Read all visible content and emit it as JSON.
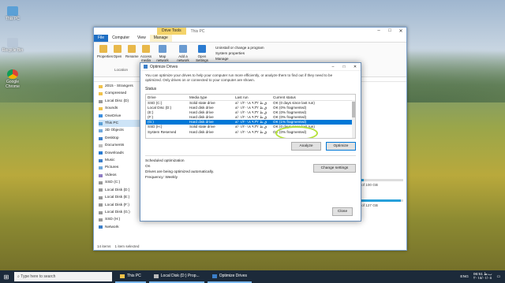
{
  "desktop": {
    "icons": [
      {
        "label": "This PC"
      },
      {
        "label": "Recycle Bin"
      },
      {
        "label": "Google Chrome"
      }
    ]
  },
  "explorer": {
    "drive_tools": "Drive Tools",
    "title": "This PC",
    "tabs": [
      "File",
      "Computer",
      "View",
      "Manage"
    ],
    "ribbon_buttons": [
      "Properties",
      "Open",
      "Rename",
      "Access media",
      "Map network drive",
      "Add a network location",
      "Open Settings"
    ],
    "ribbon_right": [
      "Uninstall or change a program",
      "System properties",
      "Manage"
    ],
    "location_label": "Location",
    "nav": [
      {
        "label": "2015 - Strangers"
      },
      {
        "label": "Compressed"
      },
      {
        "label": "Local Disc (D)"
      },
      {
        "label": "Sounds"
      },
      {
        "label": "OneDrive"
      },
      {
        "label": "This PC"
      },
      {
        "label": "3D Objects"
      },
      {
        "label": "Desktop"
      },
      {
        "label": "Documents"
      },
      {
        "label": "Downloads"
      },
      {
        "label": "Music"
      },
      {
        "label": "Pictures"
      },
      {
        "label": "Videos"
      },
      {
        "label": "SSD (C:)"
      },
      {
        "label": "Local Disk (D:)"
      },
      {
        "label": "Local Disk (E:)"
      },
      {
        "label": "Local Disk (F:)"
      },
      {
        "label": "Local Disk (G:)"
      },
      {
        "label": "SSD (H:)"
      },
      {
        "label": "Network"
      }
    ],
    "status": "14 items",
    "status2": "1 item selected",
    "right_free1": "free of 100 GB",
    "right_free2": "free of 127 GB",
    "bar1": 0.2,
    "bar2": 0.95
  },
  "dialog": {
    "title": "Optimize Drives",
    "intro": "You can optimize your drives to help your computer run more efficiently, or analyze them to find out if they need to be optimized. Only drives on or connected to your computer are shown.",
    "status_label": "Status",
    "columns": [
      "Drive",
      "Media type",
      "Last run",
      "Current status"
    ],
    "rows": [
      {
        "drive": "SSD (C:)",
        "media": "Solid state drive",
        "last_run": "۸/۰۱/۲۰۱۸ ۹:۳۲ ق.ظ",
        "status": "OK (0 days since last run)"
      },
      {
        "drive": "Local Disc (D:)",
        "media": "Hard disk drive",
        "last_run": "۸/۰۱/۲۰۱۸ ۹:۳۲ ق.ظ",
        "status": "OK (0% fragmented)"
      },
      {
        "drive": "(E:)",
        "media": "Hard disk drive",
        "last_run": "۸/۰۱/۲۰۱۸ ۹:۳۲ ق.ظ",
        "status": "OK (0% fragmented)"
      },
      {
        "drive": "(F:)",
        "media": "Hard disk drive",
        "last_run": "۸/۰۱/۲۰۱۸ ۹:۳۲ ق.ظ",
        "status": "OK (0% fragmented)"
      },
      {
        "drive": "(G:)",
        "media": "Hard disk drive",
        "last_run": "۸/۰۱/۲۰۱۸ ۹:۳۲ ق.ظ",
        "status": "OK (1% fragmented)"
      },
      {
        "drive": "SSD (H:)",
        "media": "Solid state drive",
        "last_run": "۸/۰۱/۲۰۱۸ ۹:۳۲ ق.ظ",
        "status": "OK (0 days since last run)"
      },
      {
        "drive": "System Reserved",
        "media": "Hard disk drive",
        "last_run": "۸/۰۱/۲۰۱۸ ۹:۳۲ ق.ظ",
        "status": "OK (0% fragmented)"
      }
    ],
    "selected_row": 4,
    "analyze": "Analyze",
    "optimize": "Optimize",
    "scheduled_label": "Scheduled optimization",
    "sched_on": "On",
    "sched_line1": "Drives are being optimized automatically.",
    "sched_line2": "Frequency: Weekly",
    "change_settings": "Change settings",
    "close": "Close"
  },
  "taskbar": {
    "search_placeholder": "Type here to search",
    "items": [
      "This PC",
      "Local Disk (D:) Prop...",
      "Optimize Drives"
    ],
    "lang": "ENG",
    "time": "06:51 ب.ظ",
    "date": "۲۰۱۸/۰۱/۰۸"
  },
  "colors": {
    "accent": "#0078d7",
    "highlight_circle": "#b6e23c",
    "drive_tools": "#f4d36a"
  }
}
